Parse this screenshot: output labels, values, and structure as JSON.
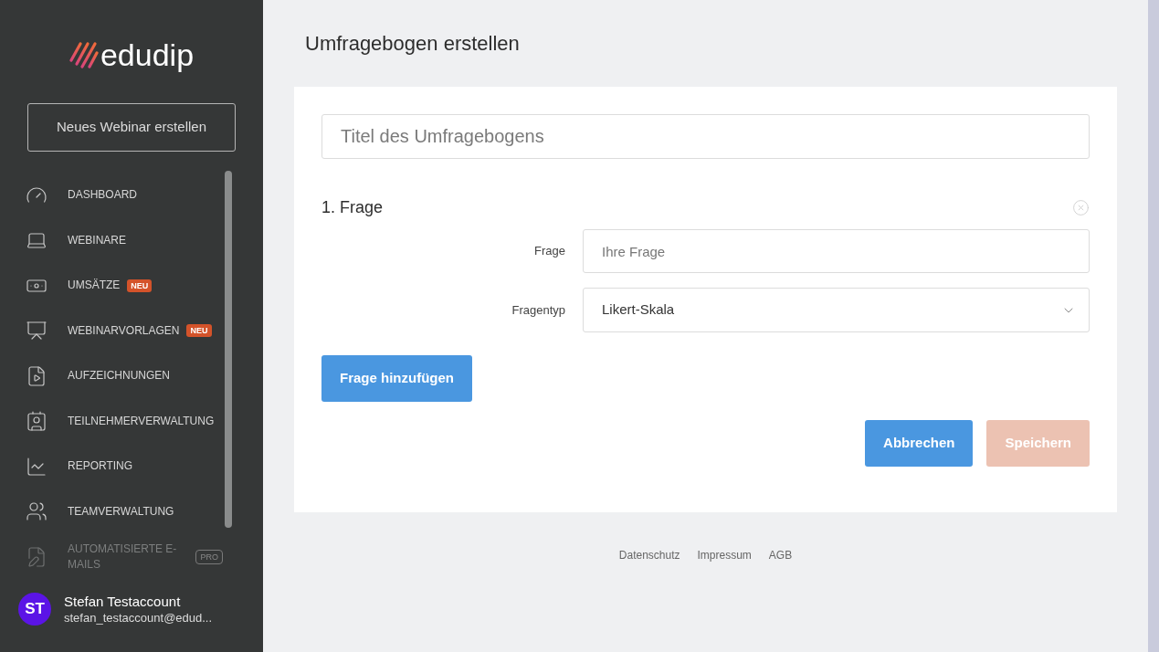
{
  "sidebar": {
    "logo": {
      "text": "edudip"
    },
    "new_webinar_button": "Neues Webinar erstellen",
    "nav_items": [
      {
        "label": "DASHBOARD",
        "disabled": false
      },
      {
        "label": "WEBINARE",
        "disabled": false
      },
      {
        "label": "UMSÄTZE",
        "disabled": false,
        "badge": {
          "text": "NEU",
          "kind": "new"
        }
      },
      {
        "label": "WEBINARVORLAGEN",
        "disabled": false,
        "badge": {
          "text": "NEU",
          "kind": "new"
        }
      },
      {
        "label": "AUFZEICHNUNGEN",
        "disabled": false
      },
      {
        "label": "TEILNEHMERVERWALTUNG",
        "disabled": false
      },
      {
        "label": "REPORTING",
        "disabled": false
      },
      {
        "label": "TEAMVERWALTUNG",
        "disabled": false
      },
      {
        "label": "AUTOMATISIERTE E-MAILS",
        "disabled": true,
        "badge": {
          "text": "PRO",
          "kind": "pro"
        }
      }
    ],
    "user": {
      "initials": "ST",
      "name": "Stefan Testaccount",
      "email": "stefan_testaccount@edud..."
    }
  },
  "page_title": "Umfragebogen erstellen",
  "form": {
    "title_field": {
      "placeholder": "Titel des Umfragebogens"
    },
    "questions": [
      {
        "heading": "1. Frage",
        "fields": [
          {
            "kind": "text",
            "label": "Frage",
            "placeholder": "Ihre Frage"
          },
          {
            "kind": "select",
            "label": "Fragentyp",
            "value": "Likert-Skala"
          }
        ]
      }
    ],
    "add_question_button": "Frage hinzufügen",
    "actions": [
      {
        "label": "Abbrechen",
        "disabled": false
      },
      {
        "label": "Speichern",
        "disabled": true
      }
    ]
  },
  "footer_links": [
    "Datenschutz",
    "Impressum",
    "AGB"
  ]
}
